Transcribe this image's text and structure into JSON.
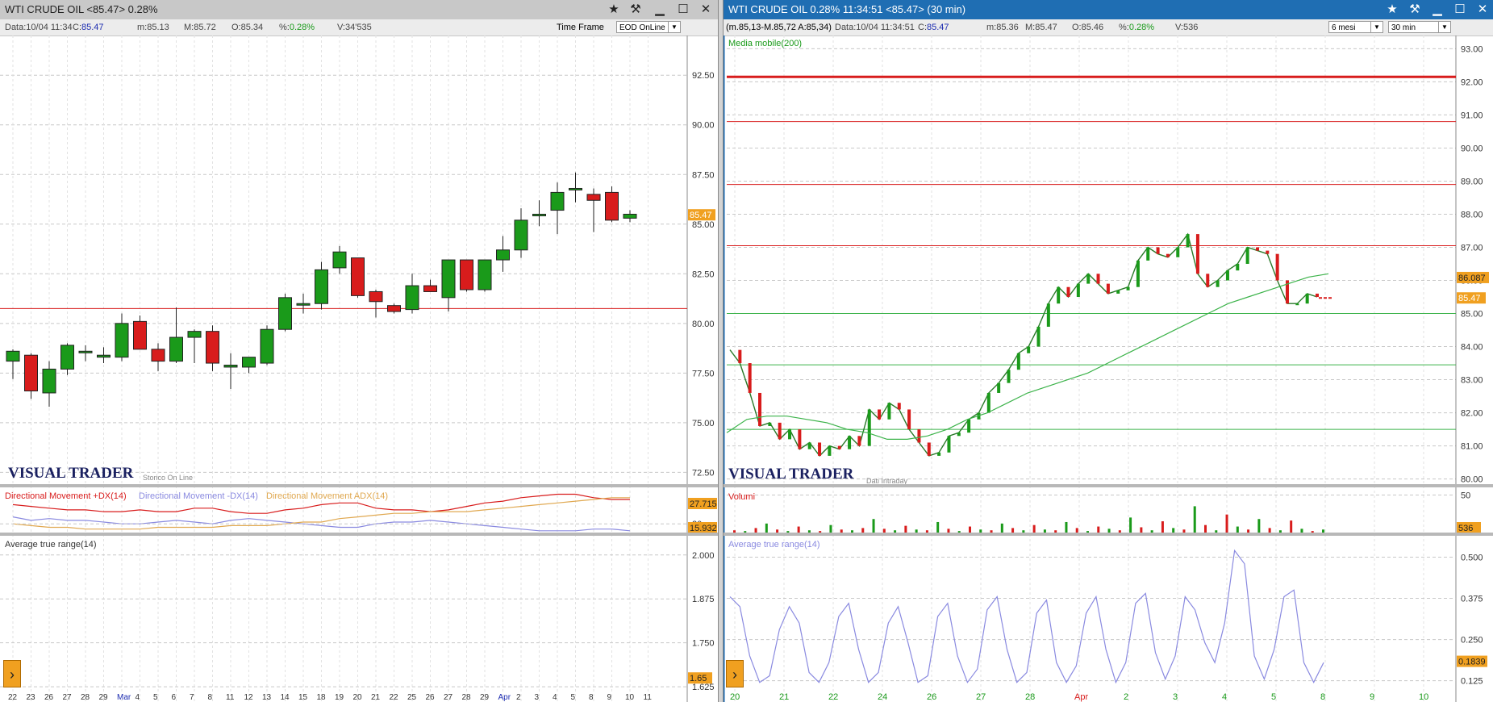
{
  "left": {
    "title": "WTI CRUDE OIL <85.47> 0.28%",
    "info": {
      "data_label": "Data:",
      "data_value": "10/04 11:34",
      "c_label": "C:",
      "c_value": "85.47",
      "m_label": "m:",
      "m_value": "85.13",
      "M_label": "M:",
      "M_value": "85.72",
      "o_label": "O:",
      "o_value": "85.34",
      "pct_label": "%:",
      "pct_value": "0.28%",
      "v_label": "V:",
      "v_value": "34'535"
    },
    "timeframe_label": "Time Frame",
    "timeframe_value": "EOD OnLine",
    "brand": "VISUAL TRADER",
    "brand_sub": "Storico On Line",
    "price_tag": "85.47",
    "dm_plus_label": "Directional Movement +DX(14)",
    "dm_minus_label": "Directional Movement -DX(14)",
    "dm_adx_label": "Directional Movement ADX(14)",
    "dm_tag_top": "27.715",
    "dm_tag_bottom": "15.932",
    "dm_axis_label": "20",
    "atr_label": "Average true range(14)",
    "atr_tag": "1.65"
  },
  "right": {
    "title": "WTI CRUDE OIL 0.28% 11:34:51 <85.47> (30 min)",
    "info": {
      "range_text": "(m.85,13-M.85,72 A:85,34)",
      "data_label": "Data:",
      "data_value": "10/04 11:34:51",
      "c_label": "C:",
      "c_value": "85.47",
      "m_label": "m:",
      "m_value": "85.36",
      "M_label": "M:",
      "M_value": "85.47",
      "o_label": "O:",
      "o_value": "85.46",
      "pct_label": "%:",
      "pct_value": "0.28%",
      "v_label": "V:",
      "v_value": "536"
    },
    "period_value": "6 mesi",
    "interval_value": "30 min",
    "ma_label": "Media mobile(200)",
    "ma_tag": "86.087",
    "price_tag": "85.47",
    "brand": "VISUAL TRADER",
    "brand_sub": "Dati Intraday",
    "vol_label": "Volumi",
    "vol_axis_label": "50",
    "vol_tag": "536",
    "atr_label": "Average true range(14)",
    "atr_tag": "0.1839"
  },
  "colors": {
    "bull": "#1a9a1a",
    "bear": "#d81c1c",
    "price_tag": "#f0a020",
    "ma": "#3cb34a",
    "atr": "#8a8ae0",
    "dm_plus": "#d81c1c",
    "dm_minus": "#8a8ae0",
    "dm_adx": "#e0a850",
    "grid": "#c8c8c8"
  },
  "chart_data": [
    {
      "type": "candlestick",
      "panel": "left-price",
      "x": [
        "22",
        "23",
        "26",
        "27",
        "28",
        "29",
        "Mar 1",
        "4",
        "5",
        "6",
        "7",
        "8",
        "11",
        "12",
        "13",
        "14",
        "15",
        "18",
        "19",
        "20",
        "21",
        "22",
        "25",
        "26",
        "27",
        "28",
        "29",
        "Apr 1",
        "2",
        "3",
        "4",
        "5",
        "8",
        "9",
        "10"
      ],
      "x_tick_labels": [
        "22",
        "23",
        "26",
        "27",
        "28",
        "29",
        "Mar",
        "4",
        "5",
        "6",
        "7",
        "8",
        "11",
        "12",
        "13",
        "14",
        "15",
        "18",
        "19",
        "20",
        "21",
        "22",
        "25",
        "26",
        "27",
        "28",
        "29",
        "Apr",
        "2",
        "3",
        "4",
        "5",
        "8",
        "9",
        "10",
        "11"
      ],
      "ohlc": [
        [
          78.1,
          78.7,
          77.2,
          78.6
        ],
        [
          78.4,
          78.5,
          76.2,
          76.6
        ],
        [
          76.5,
          78.1,
          75.8,
          77.7
        ],
        [
          77.7,
          79.0,
          77.4,
          78.9
        ],
        [
          78.6,
          78.9,
          78.1,
          78.6
        ],
        [
          78.3,
          78.8,
          78.0,
          78.4
        ],
        [
          78.3,
          80.5,
          78.1,
          80.0
        ],
        [
          80.1,
          80.4,
          78.7,
          78.7
        ],
        [
          78.7,
          79.0,
          77.6,
          78.1
        ],
        [
          78.1,
          80.8,
          78.0,
          79.3
        ],
        [
          79.3,
          79.7,
          78.0,
          79.6
        ],
        [
          79.6,
          79.9,
          77.6,
          78.0
        ],
        [
          77.8,
          78.5,
          76.7,
          77.9
        ],
        [
          77.8,
          78.3,
          77.5,
          78.3
        ],
        [
          78.0,
          79.9,
          77.9,
          79.7
        ],
        [
          79.7,
          81.5,
          79.6,
          81.3
        ],
        [
          81.0,
          81.5,
          80.5,
          81.0
        ],
        [
          81.0,
          83.1,
          80.7,
          82.7
        ],
        [
          82.8,
          83.9,
          82.5,
          83.6
        ],
        [
          83.3,
          83.3,
          81.3,
          81.4
        ],
        [
          81.6,
          81.7,
          80.3,
          81.1
        ],
        [
          80.9,
          81.0,
          80.5,
          80.6
        ],
        [
          80.7,
          82.5,
          80.5,
          81.9
        ],
        [
          81.9,
          82.2,
          81.6,
          81.6
        ],
        [
          81.3,
          83.2,
          80.6,
          83.2
        ],
        [
          83.2,
          83.2,
          81.6,
          81.7
        ],
        [
          81.7,
          83.2,
          81.6,
          83.2
        ],
        [
          83.2,
          84.4,
          82.6,
          83.7
        ],
        [
          83.7,
          85.8,
          83.3,
          85.2
        ],
        [
          85.5,
          86.2,
          84.9,
          85.5
        ],
        [
          85.7,
          87.1,
          84.5,
          86.6
        ],
        [
          86.8,
          87.6,
          86.1,
          86.8
        ],
        [
          86.5,
          86.8,
          84.6,
          86.2
        ],
        [
          86.6,
          86.9,
          85.1,
          85.2
        ],
        [
          85.3,
          85.7,
          85.1,
          85.5
        ]
      ],
      "ylim": [
        71.5,
        94.5
      ],
      "y_ticks": [
        "92.50",
        "90.00",
        "87.50",
        "85.00",
        "82.50",
        "80.00",
        "77.50",
        "75.00",
        "72.50"
      ],
      "hlines": [
        80.75
      ]
    },
    {
      "type": "line",
      "panel": "left-directional-movement",
      "series": [
        {
          "name": "Directional Movement +DX(14)",
          "values": [
            31,
            30,
            29,
            28,
            28,
            27,
            27,
            28,
            27,
            27,
            29,
            29,
            27,
            26,
            26,
            28,
            29,
            31,
            32,
            32,
            29,
            28,
            28,
            27,
            28,
            30,
            32,
            33,
            35,
            36,
            37,
            37,
            35,
            34,
            34
          ]
        },
        {
          "name": "Directional Movement -DX(14)",
          "values": [
            24,
            22,
            23,
            22,
            22,
            21,
            20,
            20,
            21,
            22,
            21,
            20,
            22,
            23,
            22,
            21,
            20,
            19,
            18,
            18,
            20,
            21,
            21,
            22,
            21,
            20,
            19,
            18,
            17,
            16,
            16,
            16,
            17,
            17,
            16
          ]
        },
        {
          "name": "Directional Movement ADX(14)",
          "values": [
            20,
            19,
            18,
            18,
            17,
            17,
            17,
            17,
            18,
            18,
            18,
            18,
            19,
            19,
            19,
            20,
            21,
            21,
            23,
            24,
            25,
            26,
            26,
            27,
            27,
            27,
            28,
            29,
            30,
            31,
            32,
            33,
            34,
            35,
            35
          ]
        }
      ],
      "ylim": [
        15,
        40
      ]
    },
    {
      "type": "line",
      "panel": "left-atr",
      "series": [
        {
          "name": "Average true range(14)",
          "values": [
            1.52,
            1.51,
            1.55,
            1.56,
            1.55,
            1.54,
            1.57,
            1.57,
            1.56,
            1.58,
            1.58,
            1.59,
            1.6,
            1.58,
            1.59,
            1.6,
            1.58,
            1.6,
            1.6,
            1.62,
            1.61,
            1.59,
            1.6,
            1.58,
            1.6,
            1.59,
            1.6,
            1.59,
            1.61,
            1.6,
            1.62,
            1.63,
            1.63,
            1.65,
            1.65
          ]
        }
      ],
      "ylim": [
        1.6,
        2.05
      ],
      "y_ticks": [
        "2.000",
        "1.875",
        "1.750",
        "1.625"
      ]
    },
    {
      "type": "line",
      "panel": "right-intraday-price",
      "x_tick_labels": [
        "20",
        "21",
        "22",
        "24",
        "26",
        "27",
        "28",
        "Apr",
        "2",
        "3",
        "4",
        "5",
        "8",
        "9",
        "10"
      ],
      "series": [
        {
          "name": "price",
          "values": [
            83.9,
            83.5,
            82.6,
            81.6,
            81.7,
            81.2,
            81.5,
            80.9,
            81.1,
            80.7,
            81.0,
            80.9,
            81.3,
            81.0,
            82.1,
            81.8,
            82.3,
            82.1,
            81.5,
            81.1,
            80.7,
            80.8,
            81.3,
            81.4,
            81.8,
            82.0,
            82.6,
            82.9,
            83.3,
            83.8,
            84.0,
            84.6,
            85.3,
            85.8,
            85.5,
            85.9,
            86.2,
            85.9,
            85.6,
            85.7,
            85.8,
            86.6,
            87.0,
            86.8,
            86.7,
            87.0,
            87.4,
            86.2,
            85.8,
            86.0,
            86.3,
            86.5,
            87.0,
            86.9,
            86.8,
            86.0,
            85.3,
            85.3,
            85.6,
            85.5
          ]
        },
        {
          "name": "Media mobile(200)",
          "values": [
            81.4,
            81.8,
            81.9,
            81.9,
            81.8,
            81.7,
            81.5,
            81.4,
            81.2,
            81.2,
            81.3,
            81.5,
            81.8,
            82.0,
            82.3,
            82.6,
            82.8,
            83.0,
            83.2,
            83.5,
            83.8,
            84.1,
            84.4,
            84.7,
            85.0,
            85.3,
            85.5,
            85.7,
            85.9,
            86.1,
            86.2
          ]
        }
      ],
      "ylim": [
        79.6,
        93.4
      ],
      "y_ticks": [
        "93.00",
        "92.00",
        "91.00",
        "90.00",
        "89.00",
        "88.00",
        "87.00",
        "86.00",
        "85.00",
        "84.00",
        "83.00",
        "82.00",
        "81.00",
        "80.00"
      ],
      "hlines": [
        {
          "value": 92.15,
          "color": "red"
        },
        {
          "value": 90.8,
          "color": "red"
        },
        {
          "value": 88.9,
          "color": "red"
        },
        {
          "value": 87.05,
          "color": "red"
        },
        {
          "value": 85.0,
          "color": "green"
        },
        {
          "value": 83.45,
          "color": "green"
        },
        {
          "value": 81.5,
          "color": "green"
        }
      ]
    },
    {
      "type": "bar",
      "panel": "right-volume",
      "values": [
        3,
        2,
        6,
        12,
        4,
        2,
        8,
        3,
        2,
        10,
        4,
        3,
        6,
        18,
        5,
        3,
        9,
        4,
        3,
        14,
        5,
        2,
        8,
        4,
        3,
        12,
        6,
        3,
        10,
        4,
        3,
        14,
        6,
        2,
        8,
        5,
        3,
        20,
        7,
        3,
        15,
        6,
        4,
        35,
        10,
        3,
        24,
        8,
        4,
        18,
        6,
        3,
        16,
        5,
        2,
        4
      ],
      "ylim": [
        0,
        58
      ]
    },
    {
      "type": "line",
      "panel": "right-atr",
      "series": [
        {
          "name": "Average true range(14)",
          "values": [
            0.38,
            0.35,
            0.2,
            0.12,
            0.14,
            0.28,
            0.35,
            0.3,
            0.15,
            0.12,
            0.18,
            0.32,
            0.36,
            0.22,
            0.12,
            0.15,
            0.3,
            0.35,
            0.24,
            0.12,
            0.14,
            0.32,
            0.36,
            0.2,
            0.12,
            0.16,
            0.34,
            0.38,
            0.22,
            0.12,
            0.15,
            0.33,
            0.37,
            0.18,
            0.12,
            0.17,
            0.33,
            0.38,
            0.22,
            0.12,
            0.18,
            0.36,
            0.39,
            0.21,
            0.13,
            0.2,
            0.38,
            0.34,
            0.24,
            0.18,
            0.3,
            0.52,
            0.48,
            0.2,
            0.13,
            0.22,
            0.38,
            0.4,
            0.18,
            0.12,
            0.18
          ]
        }
      ],
      "ylim": [
        0.08,
        0.56
      ],
      "y_ticks": [
        "0.500",
        "0.375",
        "0.250",
        "0.125"
      ]
    }
  ]
}
